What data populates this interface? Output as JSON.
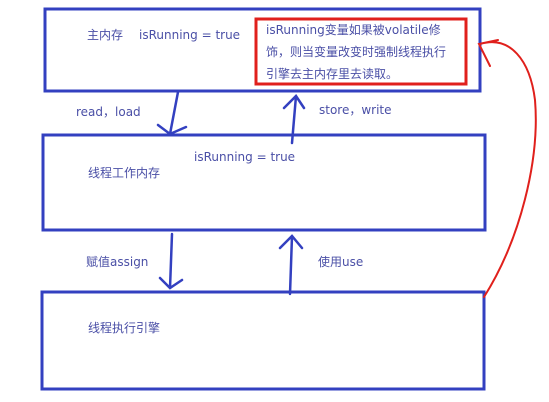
{
  "colors": {
    "box": "#3340c0",
    "highlight": "#e0201c",
    "text": "#4a4fa6"
  },
  "main_memory": {
    "label": "主内存",
    "value": "isRunning = true"
  },
  "note": {
    "lines": [
      "isRunning变量如果被volatile修",
      "饰，则当变量改变时强制线程执行",
      "引擎去主内存里去读取。"
    ]
  },
  "arrows": {
    "read_load": "read，load",
    "store_write": "store，write",
    "assign": "赋值assign",
    "use": "使用use"
  },
  "working_memory": {
    "label": "线程工作内存",
    "value": "isRunning = true"
  },
  "engine": {
    "label": "线程执行引擎"
  }
}
